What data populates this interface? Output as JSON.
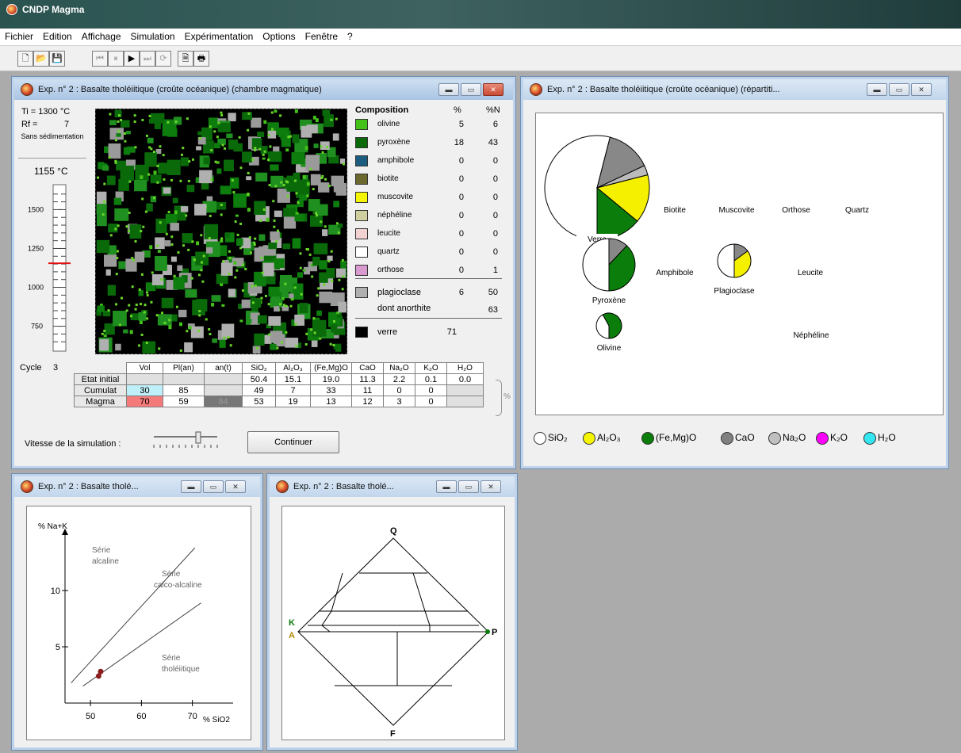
{
  "app": {
    "title": "CNDP Magma"
  },
  "menu": [
    "Fichier",
    "Edition",
    "Affichage",
    "Simulation",
    "Expérimentation",
    "Options",
    "Fenêtre",
    "?"
  ],
  "toolbar": [
    {
      "icon": "new-document-icon",
      "glyph": "🗋",
      "enabled": true
    },
    {
      "icon": "open-folder-icon",
      "glyph": "📂",
      "enabled": true
    },
    {
      "icon": "save-icon",
      "glyph": "💾",
      "enabled": true
    },
    {
      "icon": "skip-to-start-icon",
      "glyph": "⏮",
      "enabled": false
    },
    {
      "icon": "pause-icon",
      "glyph": "⏸",
      "enabled": false
    },
    {
      "icon": "play-icon",
      "glyph": "▶",
      "enabled": true
    },
    {
      "icon": "skip-to-end-icon",
      "glyph": "⏭",
      "enabled": false
    },
    {
      "icon": "repeat-icon",
      "glyph": "⟳",
      "enabled": false
    },
    {
      "icon": "print-preview-icon",
      "glyph": "🗎",
      "enabled": true
    },
    {
      "icon": "print-icon",
      "glyph": "🖶",
      "enabled": true
    }
  ],
  "chamber": {
    "title": "Exp. n° 2 : Basalte tholéiitique (croûte océanique) (chambre magmatique)",
    "ti": "Ti = 1300 °C",
    "rf_label": "Rf =",
    "rf_value": "7",
    "sedimentation": "Sans sédimentation",
    "temperature": "1155 °C",
    "temperature_value": 1155,
    "scale": {
      "min": 600,
      "max": 1650,
      "ticks": [
        "1500",
        "1250",
        "1000",
        "750"
      ],
      "tick_values": [
        1500,
        1250,
        1000,
        750
      ]
    },
    "crystal_fraction_of_grid": 0.29,
    "composition": {
      "header": [
        "Composition",
        "%",
        "%N"
      ],
      "rows": [
        {
          "name": "olivine",
          "pct": "5",
          "pctN": "6",
          "color": "#44c21a"
        },
        {
          "name": "pyroxène",
          "pct": "18",
          "pctN": "43",
          "color": "#0a6a0a"
        },
        {
          "name": "amphibole",
          "pct": "0",
          "pctN": "0",
          "color": "#1c5c80"
        },
        {
          "name": "biotite",
          "pct": "0",
          "pctN": "0",
          "color": "#6b6830"
        },
        {
          "name": "muscovite",
          "pct": "0",
          "pctN": "0",
          "color": "#f5f500"
        },
        {
          "name": "néphéline",
          "pct": "0",
          "pctN": "0",
          "color": "#cfcfa0"
        },
        {
          "name": "leucite",
          "pct": "0",
          "pctN": "0",
          "color": "#f3d2d2"
        },
        {
          "name": "quartz",
          "pct": "0",
          "pctN": "0",
          "color": "#ffffff"
        },
        {
          "name": "orthose",
          "pct": "0",
          "pctN": "1",
          "color": "#d99ad0"
        }
      ],
      "plagioclase": {
        "name": "plagioclase",
        "pct": "6",
        "pctN": "50",
        "color": "#b0b0b0"
      },
      "anorthite": {
        "name": "dont anorthite",
        "pctN": "63"
      },
      "verre": {
        "name": "verre",
        "pct": "71",
        "color": "#000000"
      }
    },
    "table": {
      "cycle_label": "Cycle",
      "cycle_value": "3",
      "headers": [
        "Vol",
        "Pl(an)",
        "an(t)",
        "SiO₂",
        "Al₂O₃",
        "(Fe,Mg)O",
        "CaO",
        "Na₂O",
        "K₂O",
        "H₂O"
      ],
      "rows": [
        {
          "label": "Etat initial",
          "cells": [
            "",
            "",
            "",
            "50.4",
            "15.1",
            "19.0",
            "11.3",
            "2.2",
            "0.1",
            "0.0"
          ]
        },
        {
          "label": "Cumulat",
          "cells": [
            "30",
            "85",
            "",
            "49",
            "7",
            "33",
            "11",
            "0",
            "0",
            ""
          ]
        },
        {
          "label": "Magma",
          "cells": [
            "70",
            "59",
            "84",
            "53",
            "19",
            "13",
            "12",
            "3",
            "0",
            ""
          ]
        }
      ],
      "pct_label": "%"
    },
    "speed_label": "Vitesse de la simulation :",
    "speed_value": 0.7,
    "continue_button": "Continuer"
  },
  "distribution": {
    "title": "Exp. n° 2 : Basalte tholéiitique (croûte océanique) (répartiti...",
    "pies": [
      {
        "label": "Verre",
        "slices": [
          {
            "color": "#ffffff",
            "value": 0.54
          },
          {
            "color": "#888888",
            "value": 0.14
          },
          {
            "color": "#bbbbbb",
            "value": 0.03
          },
          {
            "color": "#f5ef00",
            "value": 0.15
          },
          {
            "color": "#0b7d0b",
            "value": 0.14
          }
        ]
      },
      {
        "label": "Pyroxène",
        "slices": [
          {
            "color": "#ffffff",
            "value": 0.5
          },
          {
            "color": "#888888",
            "value": 0.12
          },
          {
            "color": "#0b7d0b",
            "value": 0.38
          }
        ]
      },
      {
        "label": "Plagioclase",
        "slices": [
          {
            "color": "#ffffff",
            "value": 0.5
          },
          {
            "color": "#888888",
            "value": 0.15
          },
          {
            "color": "#f5ef00",
            "value": 0.35
          }
        ]
      },
      {
        "label": "Olivine",
        "slices": [
          {
            "color": "#ffffff",
            "value": 0.42
          },
          {
            "color": "#0b7d0b",
            "value": 0.58
          }
        ]
      }
    ],
    "empty_labels": [
      "Biotite",
      "Muscovite",
      "Orthose",
      "Quartz",
      "Amphibole",
      "Leucite",
      "Néphéline"
    ],
    "legend": [
      {
        "label": "SiO₂",
        "color": "#ffffff"
      },
      {
        "label": "Al₂O₃",
        "color": "#f5f500"
      },
      {
        "label": "(Fe,Mg)O",
        "color": "#0b7d0b"
      },
      {
        "label": "CaO",
        "color": "#808080"
      },
      {
        "label": "Na₂O",
        "color": "#c0c0c0"
      },
      {
        "label": "K₂O",
        "color": "#ff00ff"
      },
      {
        "label": "H₂O",
        "color": "#33e6f0"
      }
    ]
  },
  "tas": {
    "title": "Exp. n° 2 : Basalte tholé...",
    "ylabel": "% Na+K",
    "xlabel": "% SiO2",
    "xlim": [
      45,
      78
    ],
    "ylim": [
      0,
      15.5
    ],
    "x_ticks": [
      "50",
      "60",
      "70"
    ],
    "x_tick_values": [
      50,
      60,
      70
    ],
    "y_ticks": [
      "10",
      "5"
    ],
    "y_tick_values": [
      10,
      5
    ],
    "series_labels": [
      "Série alcaline",
      "Série calco-alcaline",
      "Série tholéiitique"
    ],
    "lines": [
      {
        "x": [
          46.2,
          70.5
        ],
        "y": [
          1.8,
          13.8
        ]
      },
      {
        "x": [
          48.5,
          71.7
        ],
        "y": [
          1.5,
          8.9
        ]
      }
    ],
    "points": [
      {
        "x": 52,
        "y": 2.8,
        "color": "#8b1d1d"
      },
      {
        "x": 51.6,
        "y": 2.4,
        "color": "#8b1d1d"
      }
    ]
  },
  "qapf": {
    "title": "Exp. n° 2 : Basalte tholé...",
    "labels": {
      "q": "Q",
      "f": "F",
      "k": "K",
      "a": "A",
      "p": "P"
    }
  }
}
